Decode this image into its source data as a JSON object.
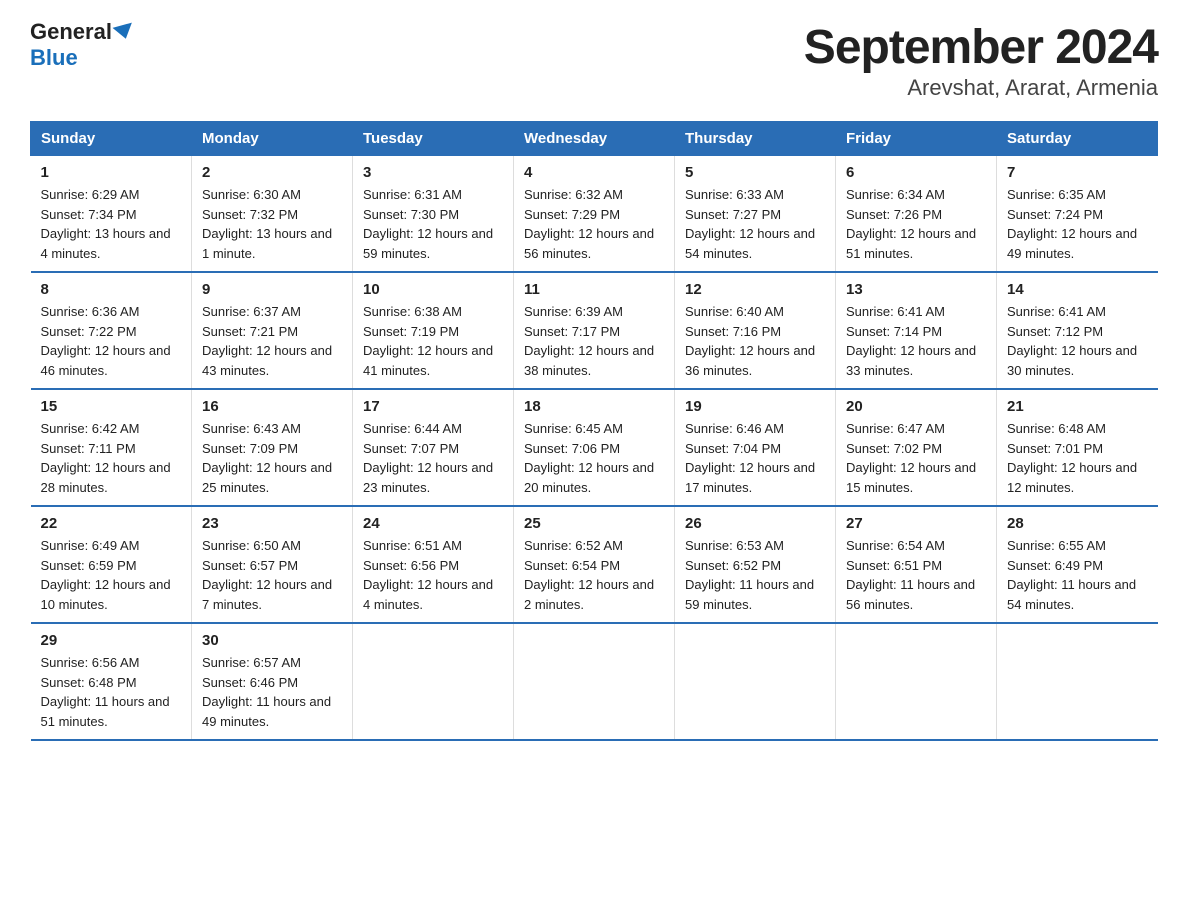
{
  "header": {
    "logo_line1": "General",
    "logo_line2": "Blue",
    "title": "September 2024",
    "subtitle": "Arevshat, Ararat, Armenia"
  },
  "days_of_week": [
    "Sunday",
    "Monday",
    "Tuesday",
    "Wednesday",
    "Thursday",
    "Friday",
    "Saturday"
  ],
  "weeks": [
    [
      {
        "day": "1",
        "sunrise": "6:29 AM",
        "sunset": "7:34 PM",
        "daylight": "13 hours and 4 minutes."
      },
      {
        "day": "2",
        "sunrise": "6:30 AM",
        "sunset": "7:32 PM",
        "daylight": "13 hours and 1 minute."
      },
      {
        "day": "3",
        "sunrise": "6:31 AM",
        "sunset": "7:30 PM",
        "daylight": "12 hours and 59 minutes."
      },
      {
        "day": "4",
        "sunrise": "6:32 AM",
        "sunset": "7:29 PM",
        "daylight": "12 hours and 56 minutes."
      },
      {
        "day": "5",
        "sunrise": "6:33 AM",
        "sunset": "7:27 PM",
        "daylight": "12 hours and 54 minutes."
      },
      {
        "day": "6",
        "sunrise": "6:34 AM",
        "sunset": "7:26 PM",
        "daylight": "12 hours and 51 minutes."
      },
      {
        "day": "7",
        "sunrise": "6:35 AM",
        "sunset": "7:24 PM",
        "daylight": "12 hours and 49 minutes."
      }
    ],
    [
      {
        "day": "8",
        "sunrise": "6:36 AM",
        "sunset": "7:22 PM",
        "daylight": "12 hours and 46 minutes."
      },
      {
        "day": "9",
        "sunrise": "6:37 AM",
        "sunset": "7:21 PM",
        "daylight": "12 hours and 43 minutes."
      },
      {
        "day": "10",
        "sunrise": "6:38 AM",
        "sunset": "7:19 PM",
        "daylight": "12 hours and 41 minutes."
      },
      {
        "day": "11",
        "sunrise": "6:39 AM",
        "sunset": "7:17 PM",
        "daylight": "12 hours and 38 minutes."
      },
      {
        "day": "12",
        "sunrise": "6:40 AM",
        "sunset": "7:16 PM",
        "daylight": "12 hours and 36 minutes."
      },
      {
        "day": "13",
        "sunrise": "6:41 AM",
        "sunset": "7:14 PM",
        "daylight": "12 hours and 33 minutes."
      },
      {
        "day": "14",
        "sunrise": "6:41 AM",
        "sunset": "7:12 PM",
        "daylight": "12 hours and 30 minutes."
      }
    ],
    [
      {
        "day": "15",
        "sunrise": "6:42 AM",
        "sunset": "7:11 PM",
        "daylight": "12 hours and 28 minutes."
      },
      {
        "day": "16",
        "sunrise": "6:43 AM",
        "sunset": "7:09 PM",
        "daylight": "12 hours and 25 minutes."
      },
      {
        "day": "17",
        "sunrise": "6:44 AM",
        "sunset": "7:07 PM",
        "daylight": "12 hours and 23 minutes."
      },
      {
        "day": "18",
        "sunrise": "6:45 AM",
        "sunset": "7:06 PM",
        "daylight": "12 hours and 20 minutes."
      },
      {
        "day": "19",
        "sunrise": "6:46 AM",
        "sunset": "7:04 PM",
        "daylight": "12 hours and 17 minutes."
      },
      {
        "day": "20",
        "sunrise": "6:47 AM",
        "sunset": "7:02 PM",
        "daylight": "12 hours and 15 minutes."
      },
      {
        "day": "21",
        "sunrise": "6:48 AM",
        "sunset": "7:01 PM",
        "daylight": "12 hours and 12 minutes."
      }
    ],
    [
      {
        "day": "22",
        "sunrise": "6:49 AM",
        "sunset": "6:59 PM",
        "daylight": "12 hours and 10 minutes."
      },
      {
        "day": "23",
        "sunrise": "6:50 AM",
        "sunset": "6:57 PM",
        "daylight": "12 hours and 7 minutes."
      },
      {
        "day": "24",
        "sunrise": "6:51 AM",
        "sunset": "6:56 PM",
        "daylight": "12 hours and 4 minutes."
      },
      {
        "day": "25",
        "sunrise": "6:52 AM",
        "sunset": "6:54 PM",
        "daylight": "12 hours and 2 minutes."
      },
      {
        "day": "26",
        "sunrise": "6:53 AM",
        "sunset": "6:52 PM",
        "daylight": "11 hours and 59 minutes."
      },
      {
        "day": "27",
        "sunrise": "6:54 AM",
        "sunset": "6:51 PM",
        "daylight": "11 hours and 56 minutes."
      },
      {
        "day": "28",
        "sunrise": "6:55 AM",
        "sunset": "6:49 PM",
        "daylight": "11 hours and 54 minutes."
      }
    ],
    [
      {
        "day": "29",
        "sunrise": "6:56 AM",
        "sunset": "6:48 PM",
        "daylight": "11 hours and 51 minutes."
      },
      {
        "day": "30",
        "sunrise": "6:57 AM",
        "sunset": "6:46 PM",
        "daylight": "11 hours and 49 minutes."
      },
      null,
      null,
      null,
      null,
      null
    ]
  ],
  "labels": {
    "sunrise": "Sunrise: ",
    "sunset": "Sunset: ",
    "daylight": "Daylight: "
  }
}
